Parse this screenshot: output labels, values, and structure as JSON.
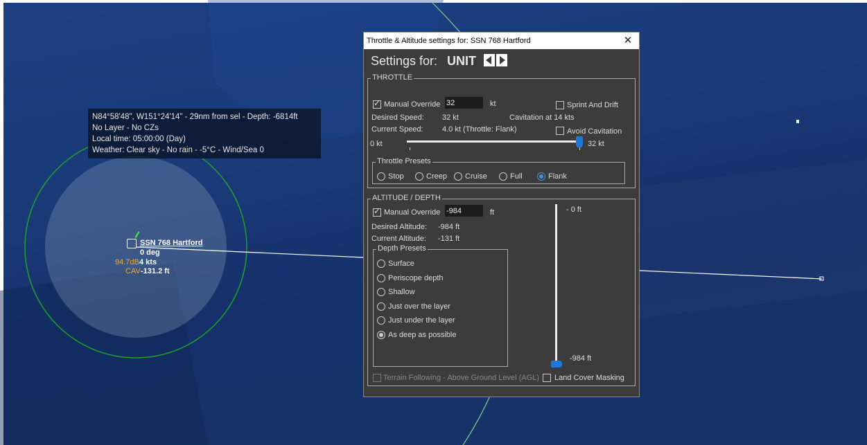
{
  "info_box": {
    "coords": "N84°58'48\", W151°24'14\" - 29nm from sel - Depth: -6814ft",
    "layer": "No Layer - No CZs",
    "local_time": "Local time: 05:00:00 (Day)",
    "weather": "Weather: Clear sky - No rain - -5°C - Wind/Sea 0"
  },
  "unit_label": {
    "name": "SSN 768 Hartford",
    "heading": "0 deg",
    "noise": "94.7dB",
    "speed": "4 kts",
    "cav": "CAV",
    "depth": "-131.2 ft"
  },
  "dialog": {
    "title": "Throttle & Altitude settings for: SSN 768 Hartford",
    "close_glyph": "✕",
    "settings_for_label": "Settings for:",
    "settings_for_value": "UNIT",
    "throttle": {
      "group_title": "THROTTLE",
      "manual_override_label": "Manual Override",
      "manual_override_checked": true,
      "manual_override_value": "32",
      "unit": "kt",
      "sprint_drift_label": "Sprint And Drift",
      "desired_speed_label": "Desired Speed:",
      "desired_speed_value": "32 kt",
      "cavitation_text": "Cavitation at 14 kts",
      "current_speed_label": "Current Speed:",
      "current_speed_value": "4.0 kt (Throttle: Flank)",
      "avoid_cavitation_label": "Avoid Cavitation",
      "slider_min_label": "0 kt",
      "slider_max_label": "32 kt",
      "slider_fraction": 1.0,
      "presets_title": "Throttle Presets",
      "presets": [
        "Stop",
        "Creep",
        "Cruise",
        "Full",
        "Flank"
      ],
      "selected_preset": "Flank"
    },
    "altitude": {
      "group_title": "ALTITUDE / DEPTH",
      "manual_override_label": "Manual Override",
      "manual_override_checked": true,
      "manual_override_value": "-984",
      "unit": "ft",
      "desired_altitude_label": "Desired Altitude:",
      "desired_altitude_value": "-984 ft",
      "current_altitude_label": "Current Altitude:",
      "current_altitude_value": "-131 ft",
      "depth_presets_title": "Depth Presets",
      "depth_presets": [
        "Surface",
        "Periscope depth",
        "Shallow",
        "Just over the layer",
        "Just under the layer",
        "As deep as possible"
      ],
      "selected_depth_preset": "As deep as possible",
      "slider_top_label": "- 0 ft",
      "slider_bottom_label": "-984 ft",
      "slider_fraction": 1.0,
      "terrain_following_label": "Terrain Following - Above Ground Level (AGL)",
      "land_cover_label": "Land Cover Masking"
    }
  },
  "colors": {
    "map_bg": "#1b3f7d",
    "range_ring": "#1fa32a",
    "track_line": "#ffffff",
    "slider_thumb": "#1e78d8",
    "label_orange": "#f0a830"
  }
}
